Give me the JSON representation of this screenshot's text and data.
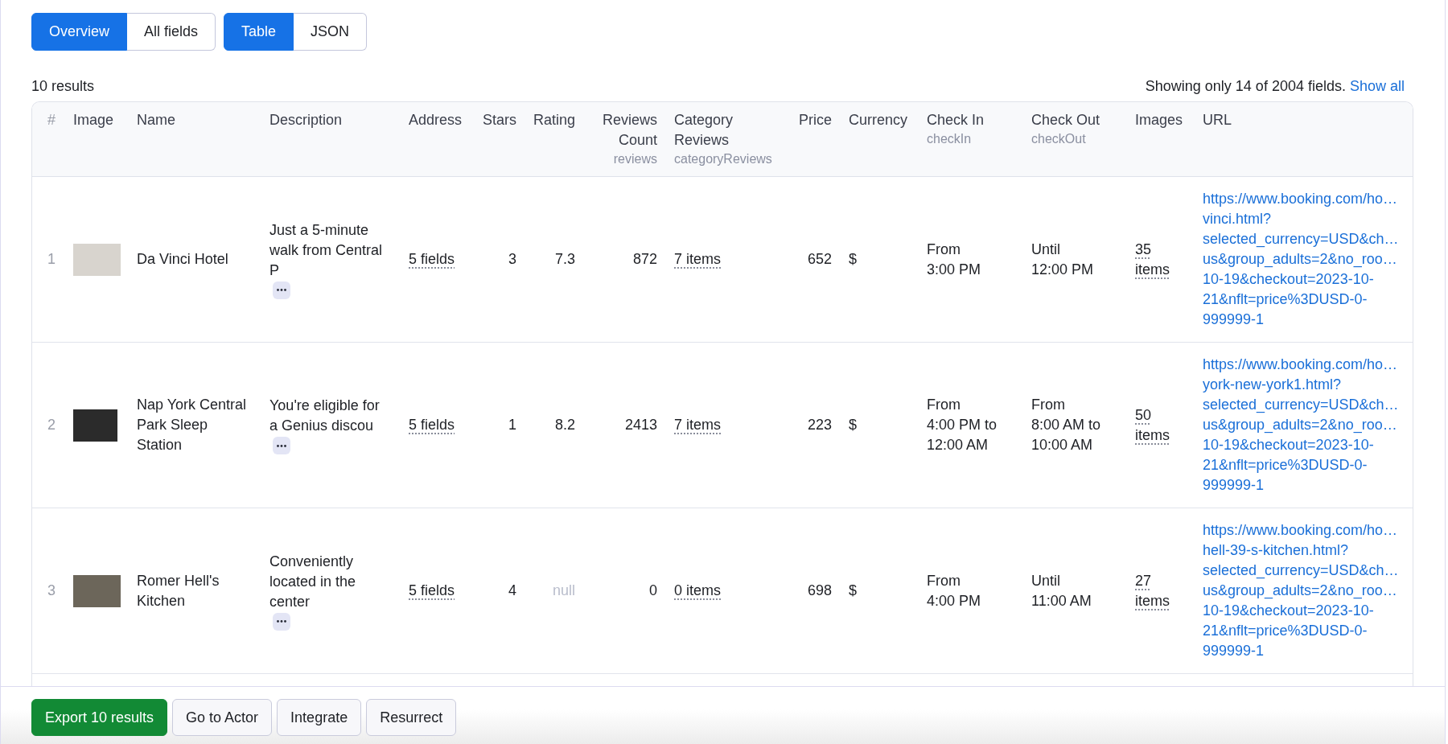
{
  "view_tabs": [
    {
      "label": "Overview",
      "selected": true
    },
    {
      "label": "All fields",
      "selected": false
    }
  ],
  "format_tabs": [
    {
      "label": "Table",
      "selected": true
    },
    {
      "label": "JSON",
      "selected": false
    }
  ],
  "result_count": "10 results",
  "fields_notice": {
    "text": "Showing only 14 of 2004 fields.",
    "link": "Show all"
  },
  "table": {
    "columns": [
      {
        "label": "#"
      },
      {
        "label": "Image"
      },
      {
        "label": "Name"
      },
      {
        "label": "Description"
      },
      {
        "label": "Address"
      },
      {
        "label": "Stars"
      },
      {
        "label": "Rating"
      },
      {
        "label": "Reviews Count",
        "field": "reviews"
      },
      {
        "label": "Category Reviews",
        "field": "categoryReviews"
      },
      {
        "label": "Price"
      },
      {
        "label": "Currency"
      },
      {
        "label": "Check In",
        "field": "checkIn"
      },
      {
        "label": "Check Out",
        "field": "checkOut"
      },
      {
        "label": "Images"
      },
      {
        "label": "URL"
      }
    ],
    "rows": [
      {
        "number": "1",
        "name": "Da Vinci Hotel",
        "description": "Just a 5-minute walk from Central P",
        "address": "5 fields",
        "hotel_stars": "3",
        "rating": "7.3",
        "rating_null": false,
        "reviews_count": "872",
        "category_reviews": "7 items",
        "price": "652",
        "currency": "$",
        "check_in_lines": [
          "From",
          "3:00 PM"
        ],
        "check_out_lines": [
          "Until",
          "12:00 PM"
        ],
        "images": "35 items",
        "url_lines": [
          "https://www.booking.com/ho…",
          "vinci.html?",
          "selected_currency=USD&ch…",
          "us&group_adults=2&no_roo…",
          "10-19&checkout=2023-10-",
          "21&nflt=price%3DUSD-0-",
          "999999-1"
        ]
      },
      {
        "number": "2",
        "name": "Nap York Central Park Sleep Station",
        "description": "You're eligible for a Genius discou",
        "address": "5 fields",
        "hotel_stars": "1",
        "rating": "8.2",
        "rating_null": false,
        "reviews_count": "2413",
        "category_reviews": "7 items",
        "price": "223",
        "currency": "$",
        "check_in_lines": [
          "From",
          "4:00 PM to",
          "12:00 AM"
        ],
        "check_out_lines": [
          "From",
          "8:00 AM to",
          "10:00 AM"
        ],
        "images": "50 items",
        "url_lines": [
          "https://www.booking.com/ho…",
          "york-new-york1.html?",
          "selected_currency=USD&ch…",
          "us&group_adults=2&no_roo…",
          "10-19&checkout=2023-10-",
          "21&nflt=price%3DUSD-0-",
          "999999-1"
        ]
      },
      {
        "number": "3",
        "name": "Romer Hell's Kitchen",
        "description": "Conveniently located in the center",
        "address": "5 fields",
        "hotel_stars": "4",
        "rating": "null",
        "rating_null": true,
        "reviews_count": "0",
        "category_reviews": "0 items",
        "price": "698",
        "currency": "$",
        "check_in_lines": [
          "From",
          "4:00 PM"
        ],
        "check_out_lines": [
          "Until",
          "11:00 AM"
        ],
        "images": "27 items",
        "url_lines": [
          "https://www.booking.com/ho…",
          "hell-39-s-kitchen.html?",
          "selected_currency=USD&ch…",
          "us&group_adults=2&no_roo…",
          "10-19&checkout=2023-10-",
          "21&nflt=price%3DUSD-0-",
          "999999-1"
        ]
      }
    ]
  },
  "actions": [
    {
      "label": "Export 10 results",
      "kind": "primary"
    },
    {
      "label": "Go to Actor",
      "kind": "secondary"
    },
    {
      "label": "Integrate",
      "kind": "secondary"
    },
    {
      "label": "Resurrect",
      "kind": "secondary"
    }
  ]
}
